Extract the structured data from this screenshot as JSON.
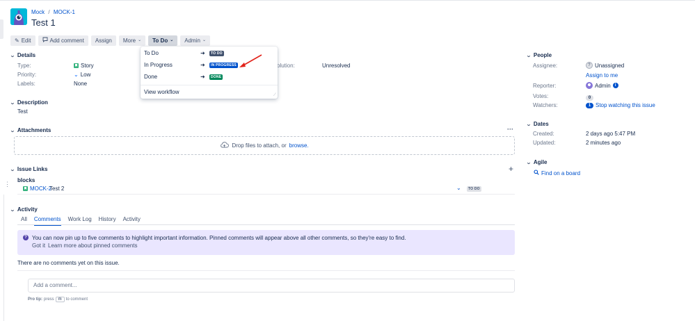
{
  "breadcrumb": {
    "project": "Mock",
    "separator": "/",
    "issue_key": "MOCK-1"
  },
  "issue_title": "Test 1",
  "toolbar": {
    "edit": "Edit",
    "add_comment": "Add comment",
    "assign": "Assign",
    "more": "More",
    "status": "To Do",
    "admin": "Admin"
  },
  "status_menu": {
    "items": [
      {
        "label": "To Do",
        "target": "TO DO",
        "color": "#42526e"
      },
      {
        "label": "In Progress",
        "target": "IN PROGRESS",
        "color": "#0052cc"
      },
      {
        "label": "Done",
        "target": "DONE",
        "color": "#00875a"
      }
    ],
    "view_workflow": "View workflow"
  },
  "details": {
    "heading": "Details",
    "type_label": "Type:",
    "type_value": "Story",
    "priority_label": "Priority:",
    "priority_value": "Low",
    "labels_label": "Labels:",
    "labels_value": "None",
    "resolution_label": "olution:",
    "resolution_value": "Unresolved"
  },
  "description": {
    "heading": "Description",
    "text": "Test"
  },
  "attachments": {
    "heading": "Attachments",
    "drop_text": "Drop files to attach, or",
    "browse": "browse."
  },
  "issue_links": {
    "heading": "Issue Links",
    "relation": "blocks",
    "link_key": "MOCK-2",
    "link_summary": "Test 2",
    "link_status": "TO DO"
  },
  "activity": {
    "heading": "Activity",
    "tabs": [
      "All",
      "Comments",
      "Work Log",
      "History",
      "Activity"
    ],
    "active_tab": "Comments",
    "info_text": "You can now pin up to five comments to highlight important information. Pinned comments will appear above all other comments, so they're easy to find.",
    "got_it": "Got it",
    "learn_more": "Learn more about pinned comments",
    "no_comments": "There are no comments yet on this issue.",
    "comment_placeholder": "Add a comment...",
    "protip_label": "Pro tip:",
    "protip_press": "press",
    "protip_key": "m",
    "protip_rest": "to comment"
  },
  "people": {
    "heading": "People",
    "assignee_label": "Assignee:",
    "assignee_value": "Unassigned",
    "assign_to_me": "Assign to me",
    "reporter_label": "Reporter:",
    "reporter_value": "Admin",
    "votes_label": "Votes:",
    "votes_value": "0",
    "watchers_label": "Watchers:",
    "watchers_count": "1",
    "watchers_action": "Stop watching this issue"
  },
  "dates": {
    "heading": "Dates",
    "created_label": "Created:",
    "created_value": "2 days ago 5:47 PM",
    "updated_label": "Updated:",
    "updated_value": "2 minutes ago"
  },
  "agile": {
    "heading": "Agile",
    "find_board": "Find on a board"
  },
  "colors": {
    "accent": "#0052cc",
    "arrow": "#e2231a",
    "info_bg": "#eae6ff"
  }
}
